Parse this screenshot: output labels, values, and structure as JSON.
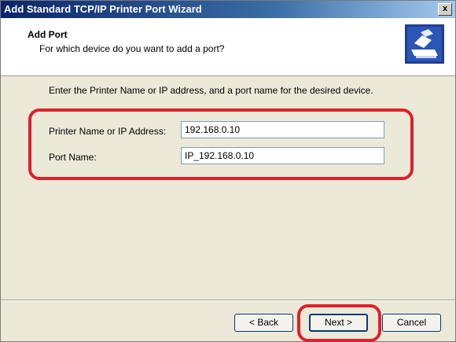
{
  "window": {
    "title": "Add Standard TCP/IP Printer Port Wizard",
    "close_glyph": "x"
  },
  "header": {
    "title": "Add Port",
    "subtitle": "For which device do you want to add a port?",
    "icon": "printer-icon"
  },
  "body": {
    "instruction": "Enter the Printer Name or IP address, and a port name for the desired device."
  },
  "fields": {
    "printer_label": "Printer Name or IP Address:",
    "printer_value": "192.168.0.10",
    "port_label": "Port Name:",
    "port_value": "IP_192.168.0.10"
  },
  "buttons": {
    "back": "< Back",
    "next": "Next >",
    "cancel": "Cancel"
  },
  "colors": {
    "highlight": "#e0202a",
    "title_bar": "#0a246a",
    "dialog_bg": "#ece9d8"
  }
}
